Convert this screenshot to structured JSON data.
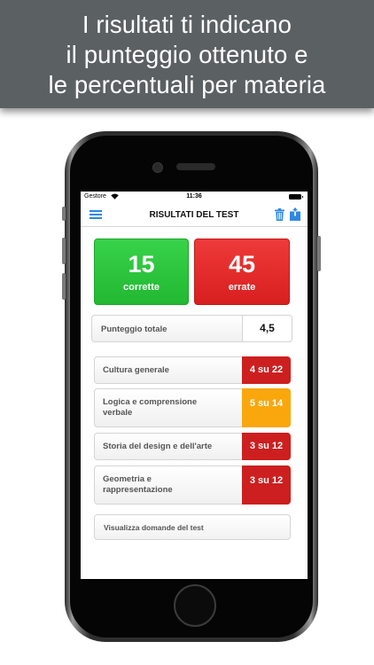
{
  "banner": {
    "line1": "I risultati ti indicano",
    "line2": "il punteggio ottenuto e",
    "line3": "le percentuali per materia"
  },
  "status_bar": {
    "carrier": "Gestore",
    "time": "11:36"
  },
  "navbar": {
    "title": "RISULTATI DEL TEST"
  },
  "scores": {
    "correct_count": "15",
    "correct_label": "corrette",
    "wrong_count": "45",
    "wrong_label": "errate"
  },
  "total": {
    "label": "Punteggio totale",
    "value": "4,5"
  },
  "subjects": [
    {
      "label_line1": "Cultura generale",
      "label_line2": "",
      "score": "4 su 22",
      "status": "red"
    },
    {
      "label_line1": "Logica e comprensione",
      "label_line2": "verbale",
      "score": "5 su 14",
      "status": "orange"
    },
    {
      "label_line1": "Storia del design e dell'arte",
      "label_line2": "",
      "score": "3 su 12",
      "status": "red"
    },
    {
      "label_line1": "Geometria e",
      "label_line2": "rappresentazione",
      "score": "3 su 12",
      "status": "red"
    }
  ],
  "actions": {
    "view_questions": "Visualizza domande del test"
  },
  "colors": {
    "correct_green": "#22b832",
    "wrong_red": "#d81f1f",
    "subject_red": "#cd1f1f",
    "subject_orange": "#f9a70d",
    "accent_blue": "#2f88e0",
    "banner_gray": "#5b6062"
  },
  "icons": {
    "menu": "hamburger-menu-icon",
    "trash": "trash-icon",
    "share": "share-icon",
    "wifi": "wifi-icon",
    "battery": "battery-icon"
  }
}
